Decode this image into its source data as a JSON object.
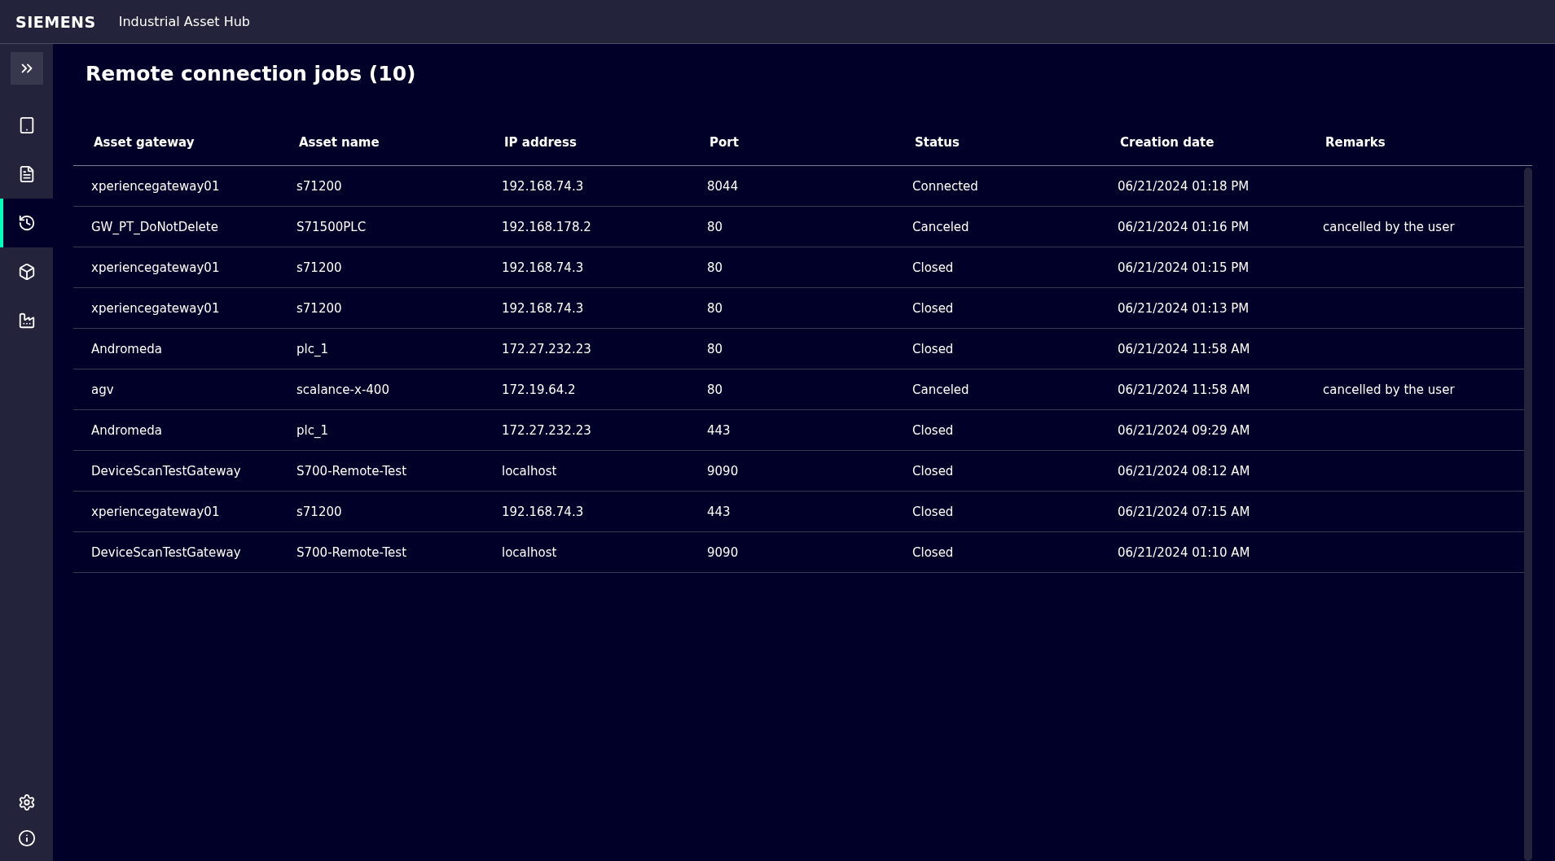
{
  "header": {
    "brand": "SIEMENS",
    "app_title": "Industrial Asset Hub"
  },
  "sidebar": {
    "items": [
      {
        "kind": "device",
        "selected": false
      },
      {
        "kind": "document",
        "selected": false
      },
      {
        "kind": "history",
        "selected": true
      },
      {
        "kind": "package",
        "selected": false
      },
      {
        "kind": "factory",
        "selected": false
      }
    ]
  },
  "page_title": "Remote connection jobs (10)",
  "table": {
    "columns": [
      "Asset gateway",
      "Asset name",
      "IP address",
      "Port",
      "Status",
      "Creation date",
      "Remarks"
    ],
    "rows": [
      [
        "xperiencegateway01",
        "s71200",
        "192.168.74.3",
        "8044",
        "Connected",
        "06/21/2024 01:18 PM",
        ""
      ],
      [
        "GW_PT_DoNotDelete",
        "S71500PLC",
        "192.168.178.2",
        "80",
        "Canceled",
        "06/21/2024 01:16 PM",
        "cancelled by the user"
      ],
      [
        "xperiencegateway01",
        "s71200",
        "192.168.74.3",
        "80",
        "Closed",
        "06/21/2024 01:15 PM",
        ""
      ],
      [
        "xperiencegateway01",
        "s71200",
        "192.168.74.3",
        "80",
        "Closed",
        "06/21/2024 01:13 PM",
        ""
      ],
      [
        "Andromeda",
        "plc_1",
        "172.27.232.23",
        "80",
        "Closed",
        "06/21/2024 11:58 AM",
        ""
      ],
      [
        "agv",
        "scalance-x-400",
        "172.19.64.2",
        "80",
        "Canceled",
        "06/21/2024 11:58 AM",
        "cancelled by the user"
      ],
      [
        "Andromeda",
        "plc_1",
        "172.27.232.23",
        "443",
        "Closed",
        "06/21/2024 09:29 AM",
        ""
      ],
      [
        "DeviceScanTestGateway",
        "S700-Remote-Test",
        "localhost",
        "9090",
        "Closed",
        "06/21/2024 08:12 AM",
        ""
      ],
      [
        "xperiencegateway01",
        "s71200",
        "192.168.74.3",
        "443",
        "Closed",
        "06/21/2024 07:15 AM",
        ""
      ],
      [
        "DeviceScanTestGateway",
        "S700-Remote-Test",
        "localhost",
        "9090",
        "Closed",
        "06/21/2024 01:10 AM",
        ""
      ]
    ]
  }
}
